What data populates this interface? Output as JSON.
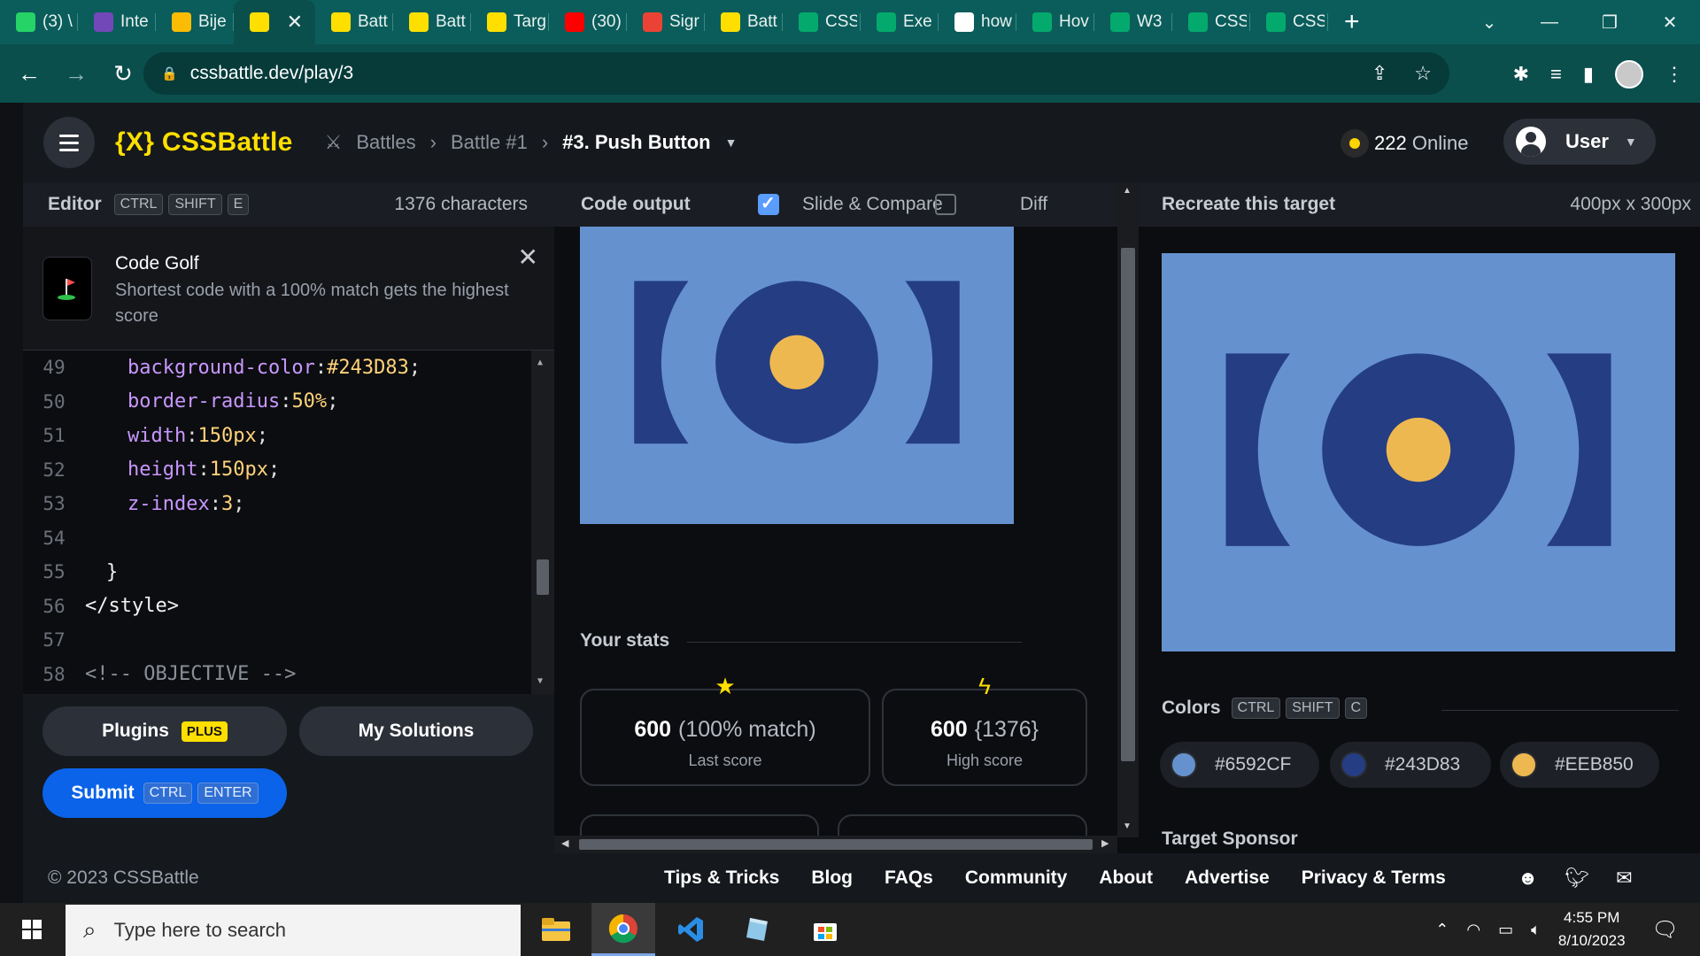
{
  "browser": {
    "tabs": [
      {
        "title": "(3) \\",
        "icon": "whatsapp-icon",
        "color": "#25d366"
      },
      {
        "title": "Inte",
        "icon": "forms-icon",
        "color": "#7248b9"
      },
      {
        "title": "Bije",
        "icon": "drive-icon",
        "color": "#fbbc04"
      },
      {
        "title": "",
        "icon": "cssbattle-icon",
        "color": "#ffdf00",
        "active": true
      },
      {
        "title": "Batt",
        "icon": "cssbattle-icon",
        "color": "#ffdf00"
      },
      {
        "title": "Batt",
        "icon": "cssbattle-icon",
        "color": "#ffdf00"
      },
      {
        "title": "Targ",
        "icon": "cssbattle-icon",
        "color": "#ffdf00"
      },
      {
        "title": "(30)",
        "icon": "youtube-icon",
        "color": "#ff0000"
      },
      {
        "title": "Sigr",
        "icon": "gmail-icon",
        "color": "#ea4335"
      },
      {
        "title": "Batt",
        "icon": "cssbattle-icon",
        "color": "#ffdf00"
      },
      {
        "title": "CSS",
        "icon": "w3schools-icon",
        "color": "#04aa6d"
      },
      {
        "title": "Exe",
        "icon": "w3schools-icon",
        "color": "#04aa6d"
      },
      {
        "title": "how",
        "icon": "google-icon",
        "color": "#ffffff"
      },
      {
        "title": "Hov",
        "icon": "w3schools-icon",
        "color": "#04aa6d"
      },
      {
        "title": "W3",
        "icon": "w3schools-icon",
        "color": "#04aa6d"
      },
      {
        "title": "CSS",
        "icon": "w3schools-icon",
        "color": "#04aa6d"
      },
      {
        "title": "CSS",
        "icon": "w3schools-icon",
        "color": "#04aa6d"
      }
    ],
    "close_glyph": "✕",
    "new_tab_glyph": "+",
    "url": "cssbattle.dev/play/3"
  },
  "header": {
    "logo": "{X} CSSBattle",
    "breadcrumb": [
      "Battles",
      "Battle #1",
      "#3. Push Button"
    ],
    "online_count": "222",
    "online_label": "Online",
    "user_label": "User"
  },
  "editor": {
    "title": "Editor",
    "keys": [
      "CTRL",
      "SHIFT",
      "E"
    ],
    "char_count": "1376 characters",
    "tip": {
      "title": "Code Golf",
      "text": "Shortest code with a 100% match gets the highest score"
    },
    "lines": [
      {
        "n": "49",
        "indent": 2,
        "prop": "background-color",
        "val": "#243D83"
      },
      {
        "n": "50",
        "indent": 2,
        "prop": "border-radius",
        "val": "50%"
      },
      {
        "n": "51",
        "indent": 2,
        "prop": "width",
        "val": "150px"
      },
      {
        "n": "52",
        "indent": 2,
        "prop": "height",
        "val": "150px"
      },
      {
        "n": "53",
        "indent": 2,
        "prop": "z-index",
        "val": "3"
      },
      {
        "n": "54",
        "indent": 0,
        "text": ""
      },
      {
        "n": "55",
        "indent": 1,
        "text": "}"
      },
      {
        "n": "56",
        "indent": 0,
        "text": "</style>"
      },
      {
        "n": "57",
        "indent": 0,
        "text": ""
      },
      {
        "n": "58",
        "indent": 0,
        "text": "<!-- OBJECTIVE -->"
      }
    ],
    "plugins_label": "Plugins",
    "plus_badge": "PLUS",
    "solutions_label": "My Solutions",
    "submit_label": "Submit",
    "submit_keys": [
      "CTRL",
      "ENTER"
    ]
  },
  "output": {
    "title": "Code output",
    "slide_label": "Slide & Compare",
    "slide_checked": true,
    "diff_label": "Diff",
    "diff_checked": false,
    "stats_title": "Your stats",
    "last_score": "600",
    "last_match": "(100% match)",
    "last_label": "Last score",
    "high_score": "600",
    "high_chars": "{1376}",
    "high_label": "High score"
  },
  "target": {
    "title": "Recreate this target",
    "dims": "400px x 300px",
    "colors_title": "Colors",
    "colors_keys": [
      "CTRL",
      "SHIFT",
      "C"
    ],
    "colors": [
      "#6592CF",
      "#243D83",
      "#EEB850"
    ],
    "sponsor_title": "Target Sponsor"
  },
  "footer": {
    "copyright": "© 2023 CSSBattle",
    "links": [
      "Tips & Tricks",
      "Blog",
      "FAQs",
      "Community",
      "About",
      "Advertise",
      "Privacy & Terms"
    ]
  },
  "taskbar": {
    "search_placeholder": "Type here to search",
    "time": "4:55 PM",
    "date": "8/10/2023"
  },
  "palette": {
    "bg": "#6592cf",
    "dark": "#243d83",
    "gold": "#eeb850",
    "brand": "#ffdf00"
  }
}
